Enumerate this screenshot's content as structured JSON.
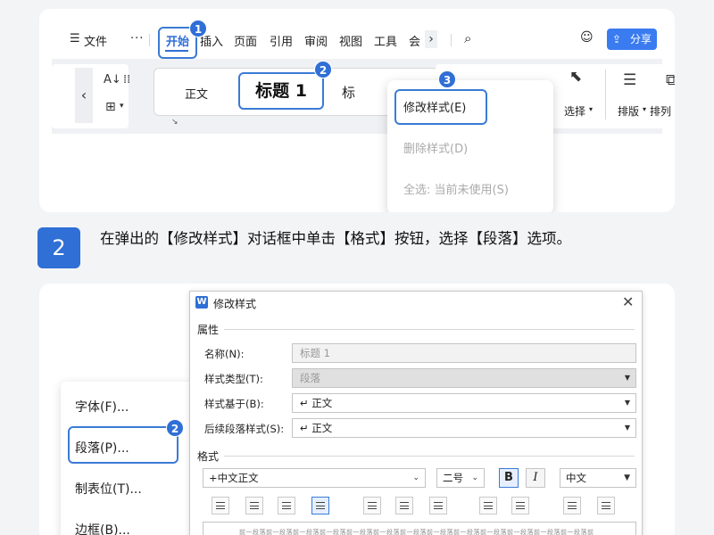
{
  "panel1": {
    "menu": {
      "items": [
        "文件",
        "开始",
        "插入",
        "页面",
        "引用",
        "审阅",
        "视图",
        "工具",
        "会"
      ],
      "active": "开始",
      "share_label": "分享"
    },
    "ribbon": {
      "style_normal": "正文",
      "style_heading1": "标题 1",
      "style_partial": "标",
      "select_label": "选择",
      "layout_label": "排版",
      "arrange_label": "排列"
    },
    "dropdown": {
      "modify_style": "修改样式(E)",
      "delete_style": "删除样式(D)",
      "select_all": "全选: 当前未使用(S)"
    },
    "badges": [
      "1",
      "2",
      "3"
    ]
  },
  "step2": {
    "number": "2",
    "text": "在弹出的【修改样式】对话框中单击【格式】按钮，选择【段落】选项。"
  },
  "panel2": {
    "format_menu": {
      "items": [
        "字体(F)...",
        "段落(P)...",
        "制表位(T)...",
        "边框(B)..."
      ],
      "badge": "2"
    },
    "dialog": {
      "title": "修改样式",
      "section_props": "属性",
      "name_label": "名称(N):",
      "name_value": "标题 1",
      "type_label": "样式类型(T):",
      "type_value": "段落",
      "based_label": "样式基于(B):",
      "based_value": "↵ 正文",
      "follow_label": "后续段落样式(S):",
      "follow_value": "↵ 正文",
      "section_format": "格式",
      "font_value": "+中文正文",
      "size_value": "二号",
      "bold": "B",
      "italic": "I",
      "lang_value": "中文",
      "preview_text": "前一段落前一段落前一段落前一段落前一段落前一段落前一段落前一段落前一段落前一段落前一段落前一段落前一段落前一段落前一段落前一段落前一段落"
    }
  }
}
